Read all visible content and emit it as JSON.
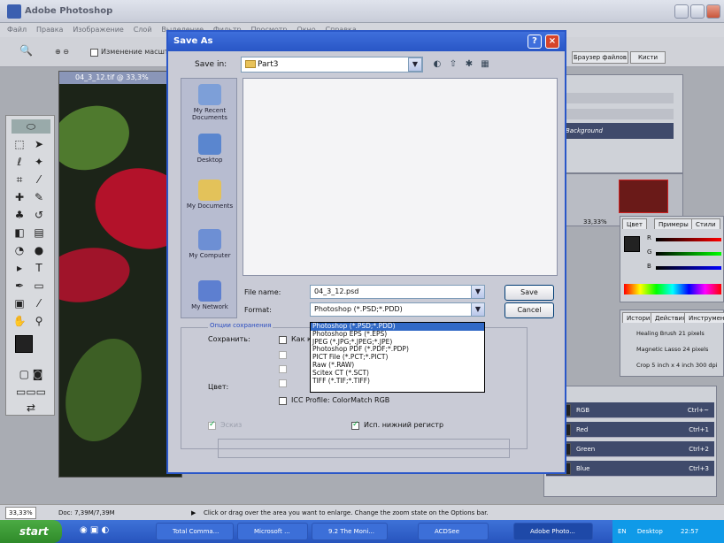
{
  "app": {
    "title": "Adobe Photoshop",
    "menu": [
      "Файл",
      "Правка",
      "Изображение",
      "Слой",
      "Выделение",
      "Фильтр",
      "Просмотр",
      "Окно",
      "Справка"
    ],
    "options_checkbox": "Изменение масштаба",
    "top_tabs": [
      "Браузер файлов",
      "Кисти"
    ]
  },
  "document": {
    "title": "04_3_12.tif @ 33,3%"
  },
  "dialog": {
    "title": "Save As",
    "help": "?",
    "close": "×",
    "save_in_label": "Save in:",
    "save_in_value": "Part3",
    "places": [
      "My Recent Documents",
      "Desktop",
      "My Documents",
      "My Computer",
      "My Network"
    ],
    "file_name_label": "File name:",
    "file_name_value": "04_3_12.psd",
    "format_label": "Format:",
    "format_value": "Photoshop (*.PSD;*.PDD)",
    "save_button": "Save",
    "cancel_button": "Cancel",
    "format_options": [
      "Photoshop (*.PSD;*.PDD)",
      "Photoshop EPS (*.EPS)",
      "JPEG (*.JPG;*.JPEG;*.JPE)",
      "Photoshop PDF (*.PDF;*.PDP)",
      "PICT File (*.PCT;*.PICT)",
      "Raw (*.RAW)",
      "Scitex CT (*.SCT)",
      "TIFF (*.TIF;*.TIFF)"
    ],
    "options_group_label": "Опции сохранения",
    "save_label": "Сохранить:",
    "as_copy_label": "Как копию",
    "color_label": "Цвет:",
    "icc_profile_label": "ICC Profile: ColorMatch RGB",
    "thumbnail_label": "Эскиз",
    "lowercase_label": "Исп. нижний регистр"
  },
  "panels": {
    "layers_row": "Background",
    "zoom": "33,33%",
    "color_tabs": [
      "Цвет",
      "Примеры",
      "Стили"
    ],
    "color_channels": [
      "R",
      "G",
      "B"
    ],
    "history_tabs": [
      "История",
      "Действия",
      "Инструменты"
    ],
    "history_items": [
      "Healing Brush 21 pixels",
      "Magnetic Lasso 24 pixels",
      "Crop 5 inch x 4 inch 300 dpi"
    ],
    "channels": [
      {
        "name": "RGB",
        "shortcut": "Ctrl+~"
      },
      {
        "name": "Red",
        "shortcut": "Ctrl+1"
      },
      {
        "name": "Green",
        "shortcut": "Ctrl+2"
      },
      {
        "name": "Blue",
        "shortcut": "Ctrl+3"
      }
    ]
  },
  "status": {
    "zoom": "33,33%",
    "doc_size": "Doc: 7,39M/7,39M",
    "hint": "Click or drag over the area you want to enlarge. Change the zoom state on the Options bar."
  },
  "taskbar": {
    "start": "start",
    "tasks": [
      "Total Comma...",
      "Microsoft ...",
      "9.2 The Moni...",
      "ACDSee",
      "Adobe Photo..."
    ],
    "lang": "EN",
    "desktop": "Desktop",
    "clock": "22:57"
  }
}
